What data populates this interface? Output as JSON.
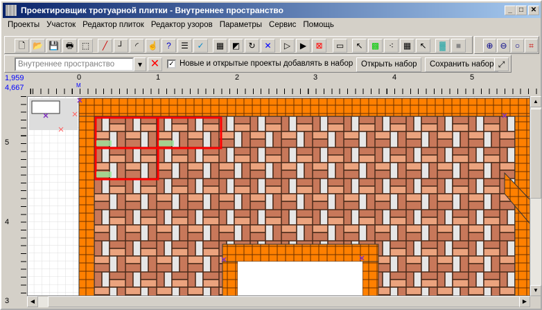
{
  "window": {
    "title": "Проектировщик тротуарной плитки - Внутреннее пространство",
    "minimize": "_",
    "maximize": "□",
    "close": "✕"
  },
  "menu": [
    "Проекты",
    "Участок",
    "Редактор плиток",
    "Редактор узоров",
    "Параметры",
    "Сервис",
    "Помощь"
  ],
  "toolbar": [
    {
      "icon": "new-file-icon",
      "glyph": "🗋"
    },
    {
      "icon": "open-folder-icon",
      "glyph": "📂"
    },
    {
      "icon": "save-icon",
      "glyph": "💾"
    },
    {
      "icon": "print-icon",
      "glyph": "🖶"
    },
    {
      "icon": "select-rect-icon",
      "glyph": "⬚"
    },
    {
      "icon": "line-icon",
      "glyph": "╱"
    },
    {
      "icon": "polyline-icon",
      "glyph": "┘"
    },
    {
      "icon": "arc-icon",
      "glyph": "◜"
    },
    {
      "icon": "edit-pointer-icon",
      "glyph": "☝"
    },
    {
      "icon": "help-query-icon",
      "glyph": "?"
    },
    {
      "icon": "list-icon",
      "glyph": "☰"
    },
    {
      "icon": "check-icon",
      "glyph": "✓"
    },
    {
      "icon": "pattern-grid-icon",
      "glyph": "▦"
    },
    {
      "icon": "color-squares-icon",
      "glyph": "◩"
    },
    {
      "icon": "rotate-icon",
      "glyph": "↻"
    },
    {
      "icon": "delete-x-icon",
      "glyph": "✕"
    },
    {
      "icon": "step-icon",
      "glyph": "▷"
    },
    {
      "icon": "play-icon",
      "glyph": "▶"
    },
    {
      "icon": "clear-icon",
      "glyph": "⊠"
    },
    {
      "icon": "rectangle-icon",
      "glyph": "▭"
    },
    {
      "icon": "arrow-select-icon",
      "glyph": "↖"
    },
    {
      "icon": "green-grid-icon",
      "glyph": "▩"
    },
    {
      "icon": "points-icon",
      "glyph": "⁖"
    },
    {
      "icon": "palette-icon",
      "glyph": "▦"
    },
    {
      "icon": "pointer-icon",
      "glyph": "↖"
    },
    {
      "icon": "texture-icon",
      "glyph": "▓"
    },
    {
      "icon": "gray-fill-icon",
      "glyph": "■"
    },
    {
      "icon": "zoom-in-icon",
      "glyph": "⊕"
    },
    {
      "icon": "zoom-out-icon",
      "glyph": "⊖"
    },
    {
      "icon": "zoom-icon",
      "glyph": "○"
    },
    {
      "icon": "fit-icon",
      "glyph": "⌗"
    }
  ],
  "projectbar": {
    "combo_value": "Внутреннее пространство",
    "checkbox_label": "Новые и открытые проекты добавлять в набор",
    "checkbox_checked": true,
    "open_set": "Открыть набор",
    "save_set": "Сохранить набор"
  },
  "ruler": {
    "coord_x": "1,959",
    "coord_y": "4,667",
    "top_marks": [
      "0",
      "1",
      "2",
      "3",
      "4",
      "5"
    ],
    "left_marks": [
      "5",
      "4",
      "3"
    ],
    "origin_mark": "M"
  },
  "colors": {
    "border": "#ff8000",
    "brick_dark": "#c8785a",
    "brick_light": "#eba37e",
    "brick_white": "#e6e6e6",
    "selection": "#ff0000"
  }
}
